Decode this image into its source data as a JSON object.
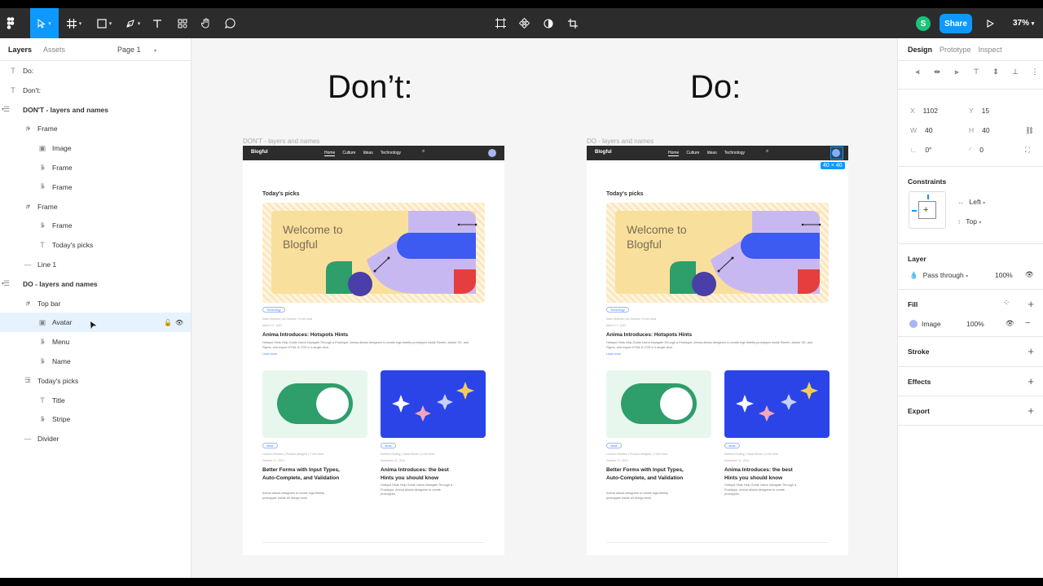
{
  "toolbar": {
    "zoom": "37%",
    "share_label": "Share",
    "user_initial": "S"
  },
  "layers_panel": {
    "tabs": [
      "Layers",
      "Assets"
    ],
    "page": "Page 1",
    "items": [
      {
        "label": "Do:",
        "icon": "text-icon",
        "indent": 0
      },
      {
        "label": "Don't:",
        "icon": "text-icon",
        "indent": 0
      },
      {
        "label": "DON'T - layers and names",
        "icon": "section-icon",
        "indent": 0
      },
      {
        "label": "Frame",
        "icon": "frame-icon",
        "indent": 1
      },
      {
        "label": "Image",
        "icon": "image-icon",
        "indent": 2
      },
      {
        "label": "Frame",
        "icon": "autolayout-h-icon",
        "indent": 2
      },
      {
        "label": "Frame",
        "icon": "autolayout-h-icon",
        "indent": 2
      },
      {
        "label": "Frame",
        "icon": "frame-icon",
        "indent": 1
      },
      {
        "label": "Frame",
        "icon": "autolayout-h-icon",
        "indent": 2
      },
      {
        "label": "Today's picks",
        "icon": "text-icon",
        "indent": 2
      },
      {
        "label": "Line 1",
        "icon": "line-icon",
        "indent": 1
      },
      {
        "label": "DO - layers and names",
        "icon": "section-icon",
        "indent": 0
      },
      {
        "label": "Top bar",
        "icon": "frame-icon",
        "indent": 1
      },
      {
        "label": "Avatar",
        "icon": "image-icon",
        "indent": 2
      },
      {
        "label": "Menu",
        "icon": "autolayout-h-icon",
        "indent": 2
      },
      {
        "label": "Name",
        "icon": "autolayout-h-icon",
        "indent": 2
      },
      {
        "label": "Today's picks",
        "icon": "autolayout-v-icon",
        "indent": 1
      },
      {
        "label": "Title",
        "icon": "text-icon",
        "indent": 2
      },
      {
        "label": "Stripe",
        "icon": "autolayout-h-icon",
        "indent": 2
      },
      {
        "label": "Divider",
        "icon": "line-icon",
        "indent": 1
      }
    ]
  },
  "canvas": {
    "left_title": "Don’t:",
    "right_title": "Do:",
    "left_frame_label": "DON'T - layers and names",
    "right_frame_label": "DO - layers and names",
    "selection_size": "40 × 40",
    "mock": {
      "brand": "Blogful",
      "nav": [
        "Home",
        "Culture",
        "Ideas",
        "Technology"
      ],
      "section_title": "Today's picks",
      "hero_text": "Welcome to Blogful",
      "post1": {
        "tag": "Technology",
        "meta": "Katie Dickens  |  Art Director  |  5 min read",
        "date": "March 17, 2022",
        "title": "Anima Introduces: Hotspots Hints",
        "text": "Hotspot Hints Help Guide Users Navigate Through a Prototype. Anima allows designers to create high fidelity prototypes inside Sketch, Adobe XD, and Figma, and export HTML & CSS in a single click.",
        "link": "Learn more"
      },
      "post2": {
        "tag": "Ideas",
        "meta": "Lorenzo Romero  |  Product designer  |  2 min read",
        "date": "October 17, 2021",
        "title": "Better Forms with Input Types, Auto-Complete, and Validation",
        "text": "Anima allows designers to create high-fidelity prototypes inside all design tools."
      },
      "post3": {
        "tag": "Ideas",
        "meta": "Mathew Reding  |  Game Boost  |  4 min read",
        "date": "November 11, 2021",
        "title": "Anima Introduces: the best Hints you should know",
        "text": "Hotspot Hints Help Guide Users Navigate Through a Prototype. Anima allows designers to create prototypes."
      }
    }
  },
  "design_panel": {
    "tabs": [
      "Design",
      "Prototype",
      "Inspect"
    ],
    "x": "1102",
    "y": "15",
    "w": "40",
    "h": "40",
    "rotation": "0°",
    "radius": "0",
    "constraints_title": "Constraints",
    "constraint_h": "Left",
    "constraint_v": "Top",
    "layer_title": "Layer",
    "blend": "Pass through",
    "layer_opacity": "100%",
    "fill_title": "Fill",
    "fill_type": "Image",
    "fill_opacity": "100%",
    "stroke_title": "Stroke",
    "effects_title": "Effects",
    "export_title": "Export"
  },
  "colors": {
    "accent": "#0d99ff",
    "toolbar_bg": "#2c2c2c",
    "hero_yellow": "#f8e09c",
    "hero_purple": "#c8b8f2",
    "hero_blue": "#3d5af1",
    "card_green": "#2e9e6a",
    "card_blue": "#2b44e8"
  }
}
